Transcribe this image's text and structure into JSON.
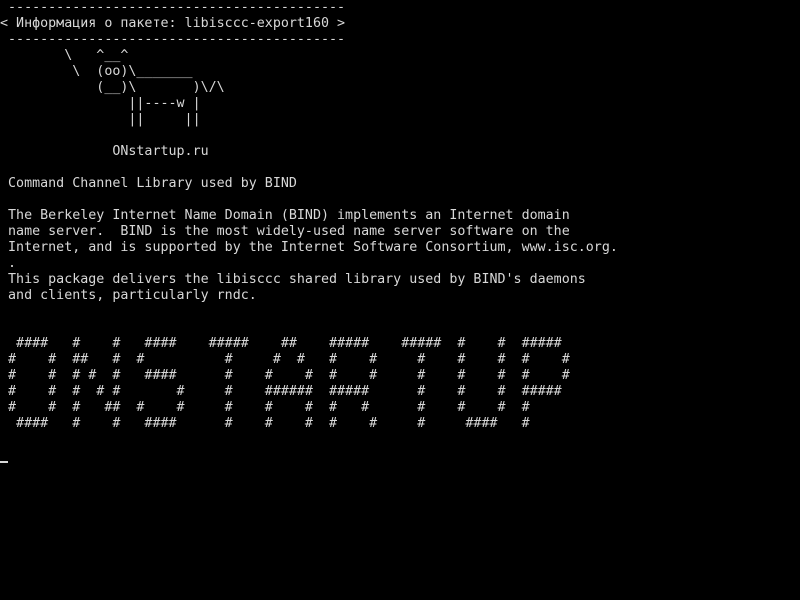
{
  "terminal": {
    "lines": [
      " ------------------------------------------",
      "< Информация о пакете: libisccc-export160 >",
      " ------------------------------------------",
      "        \\   ^__^",
      "         \\  (oo)\\_______",
      "            (__)\\       )\\/\\",
      "                ||----w |",
      "                ||     ||",
      "",
      "              ONstartup.ru",
      "",
      " Command Channel Library used by BIND",
      "",
      " The Berkeley Internet Name Domain (BIND) implements an Internet domain",
      " name server.  BIND is the most widely-used name server software on the",
      " Internet, and is supported by the Internet Software Consortium, www.isc.org.",
      " .",
      " This package delivers the libisccc shared library used by BIND's daemons",
      " and clients, particularly rndc.",
      "",
      "",
      "  ####   #    #   ####    #####    ##    #####    #####  #    #  #####",
      " #    #  ##   #  #          #     #  #   #    #     #    #    #  #    #",
      " #    #  # #  #   ####      #    #    #  #    #     #    #    #  #    #",
      " #    #  #  # #       #     #    ######  #####      #    #    #  #####",
      " #    #  #   ##  #    #     #    #    #  #   #      #    #    #  #",
      "  ####   #    #   ####      #    #    #  #    #     #     ####   #"
    ],
    "cursor": "_"
  }
}
